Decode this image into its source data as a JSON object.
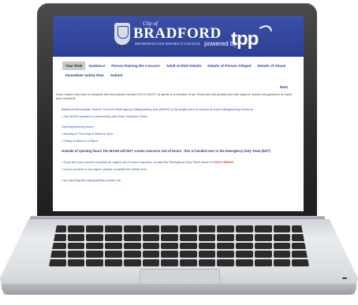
{
  "header": {
    "city_of": "City of",
    "city_name": "BRADFORD",
    "council": "METROPOLITAN DISTRICT COUNCIL",
    "powered_by": "powered by",
    "tpp": "tpp"
  },
  "tabs": [
    {
      "label": "Your Role",
      "active": true
    },
    {
      "label": "Guidance",
      "active": false
    },
    {
      "label": "Person Raising the Concern",
      "active": false
    },
    {
      "label": "Adult at Risk Details",
      "active": false
    },
    {
      "label": "Details of Person Alleged",
      "active": false
    },
    {
      "label": "Details of Abuse",
      "active": false
    },
    {
      "label": "Immediate Safety Plan",
      "active": false
    },
    {
      "label": "Submit",
      "active": false
    }
  ],
  "next_label": "Next",
  "content": {
    "intro": "If you require any help to complete this from please contact 01274 431077 to speak to a member of our Team who will provide you with support, advice and guidance to report your concerns.",
    "mash_intro": "Bradford Metropolitan District Council's Multi Agency Safeguarding Hub (MASH) is the single point of contact to report safeguarding concerns.",
    "mash_partner": "• The MASH operates in partnership with West Yorkshire Police.",
    "opening_title": "Opening/opening hours:",
    "hours_weekday": "• Monday to Thursday 8.35am to 5pm.",
    "hours_friday": "• Friday 8.35am to 4.35pm.",
    "out_of_hours": "Outside of opening hours The MASH will NOT screen concerns Out of Hours - this is handed over to the Emergency Duty Team (EDT)",
    "urgent_prefix": "• If you feel your concern requires an urgent out of hours response, contact the Emergency Duty Team direct on ",
    "urgent_number": "01274 435400",
    "not_urgent": "• If your concern is not urgent, please complete the online form.",
    "reporting": "I am reporting this safeguarding concern as:"
  }
}
